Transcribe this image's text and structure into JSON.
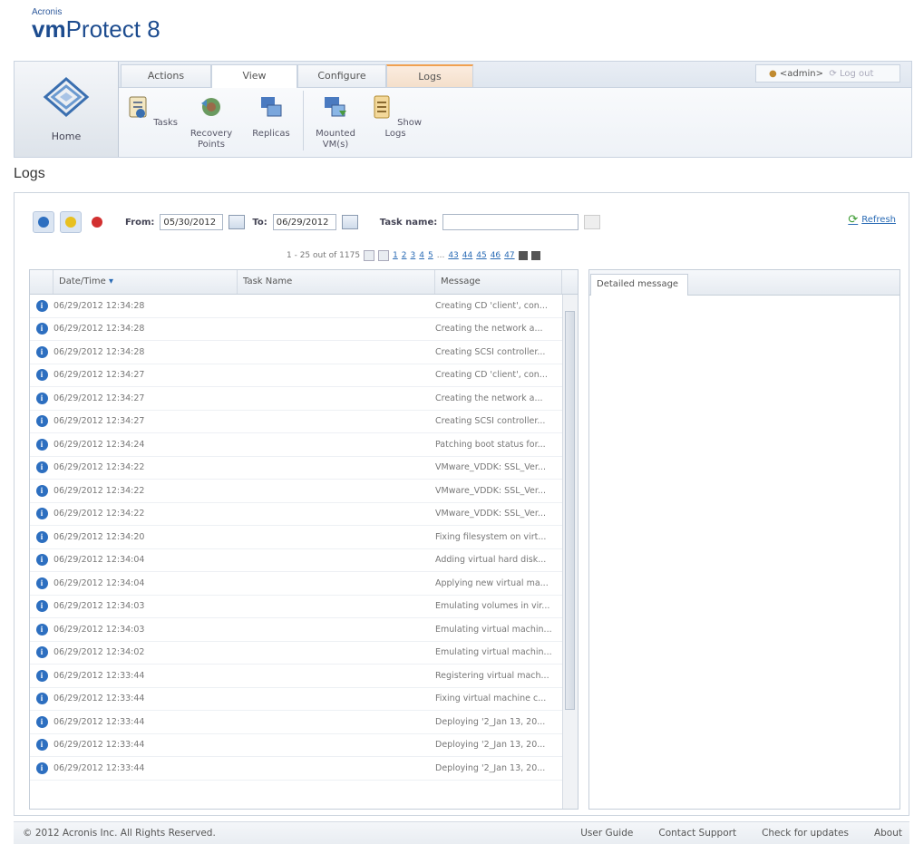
{
  "brand": {
    "company": "Acronis",
    "product_bold": "vm",
    "product_rest": "Protect",
    "version": "8"
  },
  "ribbon": {
    "home_label": "Home",
    "tabs": [
      {
        "label": "Actions",
        "active": false
      },
      {
        "label": "View",
        "active": true
      },
      {
        "label": "Configure",
        "active": false
      },
      {
        "label": "Logs",
        "active": false
      }
    ],
    "user": "<admin>",
    "logout": "Log out",
    "items": [
      {
        "line1": "Tasks",
        "line2": "",
        "icon": "tasks-icon"
      },
      {
        "line1": "Recovery",
        "line2": "Points",
        "icon": "recovery-points-icon"
      },
      {
        "line1": "Replicas",
        "line2": "",
        "icon": "replicas-icon"
      },
      {
        "line1": "Mounted",
        "line2": "VM(s)",
        "icon": "mounted-vms-icon"
      },
      {
        "line1": "Show Logs",
        "line2": "",
        "icon": "show-logs-icon"
      }
    ]
  },
  "page": {
    "title": "Logs"
  },
  "filters": {
    "from_label": "From:",
    "from_value": "05/30/2012",
    "to_label": "To:",
    "to_value": "06/29/2012",
    "task_label": "Task name:",
    "task_value": "",
    "refresh": "Refresh"
  },
  "pager": {
    "summary": "1 - 25 out of 1175",
    "pages": [
      "1",
      "2",
      "3",
      "4",
      "5",
      "...",
      "43",
      "44",
      "45",
      "46",
      "47"
    ]
  },
  "grid": {
    "col_datetime": "Date/Time",
    "col_taskname": "Task Name",
    "col_message": "Message",
    "rows": [
      {
        "datetime": "06/29/2012 12:34:28",
        "task": "",
        "message": "Creating CD 'client', con..."
      },
      {
        "datetime": "06/29/2012 12:34:28",
        "task": "",
        "message": "Creating the network a..."
      },
      {
        "datetime": "06/29/2012 12:34:28",
        "task": "",
        "message": "Creating SCSI controller..."
      },
      {
        "datetime": "06/29/2012 12:34:27",
        "task": "",
        "message": "Creating CD 'client', con..."
      },
      {
        "datetime": "06/29/2012 12:34:27",
        "task": "",
        "message": "Creating the network a..."
      },
      {
        "datetime": "06/29/2012 12:34:27",
        "task": "",
        "message": "Creating SCSI controller..."
      },
      {
        "datetime": "06/29/2012 12:34:24",
        "task": "",
        "message": "Patching boot status for..."
      },
      {
        "datetime": "06/29/2012 12:34:22",
        "task": "",
        "message": "VMware_VDDK: SSL_Ver..."
      },
      {
        "datetime": "06/29/2012 12:34:22",
        "task": "",
        "message": "VMware_VDDK: SSL_Ver..."
      },
      {
        "datetime": "06/29/2012 12:34:22",
        "task": "",
        "message": "VMware_VDDK: SSL_Ver..."
      },
      {
        "datetime": "06/29/2012 12:34:20",
        "task": "",
        "message": "Fixing filesystem on virt..."
      },
      {
        "datetime": "06/29/2012 12:34:04",
        "task": "",
        "message": "Adding virtual hard disk..."
      },
      {
        "datetime": "06/29/2012 12:34:04",
        "task": "",
        "message": "Applying new virtual ma..."
      },
      {
        "datetime": "06/29/2012 12:34:03",
        "task": "",
        "message": "Emulating volumes in vir..."
      },
      {
        "datetime": "06/29/2012 12:34:03",
        "task": "",
        "message": "Emulating virtual machin..."
      },
      {
        "datetime": "06/29/2012 12:34:02",
        "task": "",
        "message": "Emulating virtual machin..."
      },
      {
        "datetime": "06/29/2012 12:33:44",
        "task": "",
        "message": "Registering virtual mach..."
      },
      {
        "datetime": "06/29/2012 12:33:44",
        "task": "",
        "message": "Fixing virtual machine c..."
      },
      {
        "datetime": "06/29/2012 12:33:44",
        "task": "",
        "message": "Deploying '2_Jan 13, 20..."
      },
      {
        "datetime": "06/29/2012 12:33:44",
        "task": "",
        "message": "Deploying '2_Jan 13, 20..."
      },
      {
        "datetime": "06/29/2012 12:33:44",
        "task": "",
        "message": "Deploying '2_Jan 13, 20..."
      }
    ]
  },
  "detail": {
    "tab": "Detailed message"
  },
  "footer": {
    "copyright": "© 2012 Acronis Inc. All Rights Reserved.",
    "links": [
      "User Guide",
      "Contact Support",
      "Check for updates",
      "About"
    ]
  },
  "colors": {
    "info": "#2d6fc0",
    "warning": "#e8c020",
    "error": "#d23030",
    "link": "#2a6bb5"
  }
}
